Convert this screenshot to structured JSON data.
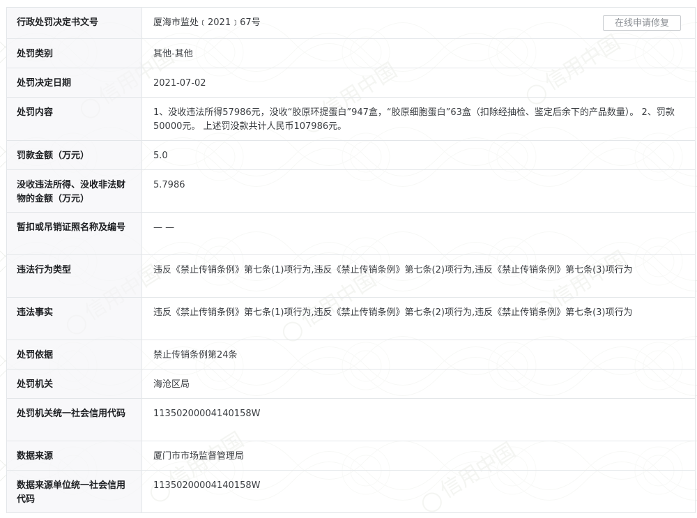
{
  "header_action": {
    "repair_label": "在线申请修复"
  },
  "rows": [
    {
      "label": "行政处罚决定书文号",
      "value": "厦海市监处﹝2021﹞67号"
    },
    {
      "label": "处罚类别",
      "value": "其他-其他"
    },
    {
      "label": "处罚决定日期",
      "value": "2021-07-02"
    },
    {
      "label": "处罚内容",
      "value": "1、没收违法所得57986元，没收“胶原环提蛋白”947盒，“胶原细胞蛋白”63盒（扣除经抽检、鉴定后余下的产品数量）。 2、罚款50000元。 上述罚没款共计人民币107986元。"
    },
    {
      "label": "罚款金额（万元）",
      "value": "5.0"
    },
    {
      "label": "没收违法所得、没收非法财物的金额（万元）",
      "value": "5.7986"
    },
    {
      "label": "暂扣或吊销证照名称及编号",
      "value": "— —"
    },
    {
      "label": "违法行为类型",
      "value": "违反《禁止传销条例》第七条(1)项行为,违反《禁止传销条例》第七条(2)项行为,违反《禁止传销条例》第七条(3)项行为"
    },
    {
      "label": "违法事实",
      "value": "违反《禁止传销条例》第七条(1)项行为,违反《禁止传销条例》第七条(2)项行为,违反《禁止传销条例》第七条(3)项行为"
    },
    {
      "label": "处罚依据",
      "value": "禁止传销条例第24条"
    },
    {
      "label": "处罚机关",
      "value": "海沧区局"
    },
    {
      "label": "处罚机关统一社会信用代码",
      "value": "11350200004140158W"
    },
    {
      "label": "数据来源",
      "value": "厦门市市场监督管理局"
    },
    {
      "label": "数据来源单位统一社会信用代码",
      "value": "11350200004140158W"
    }
  ],
  "watermark": {
    "text": "信用中国",
    "color": "#e6e9e3"
  }
}
